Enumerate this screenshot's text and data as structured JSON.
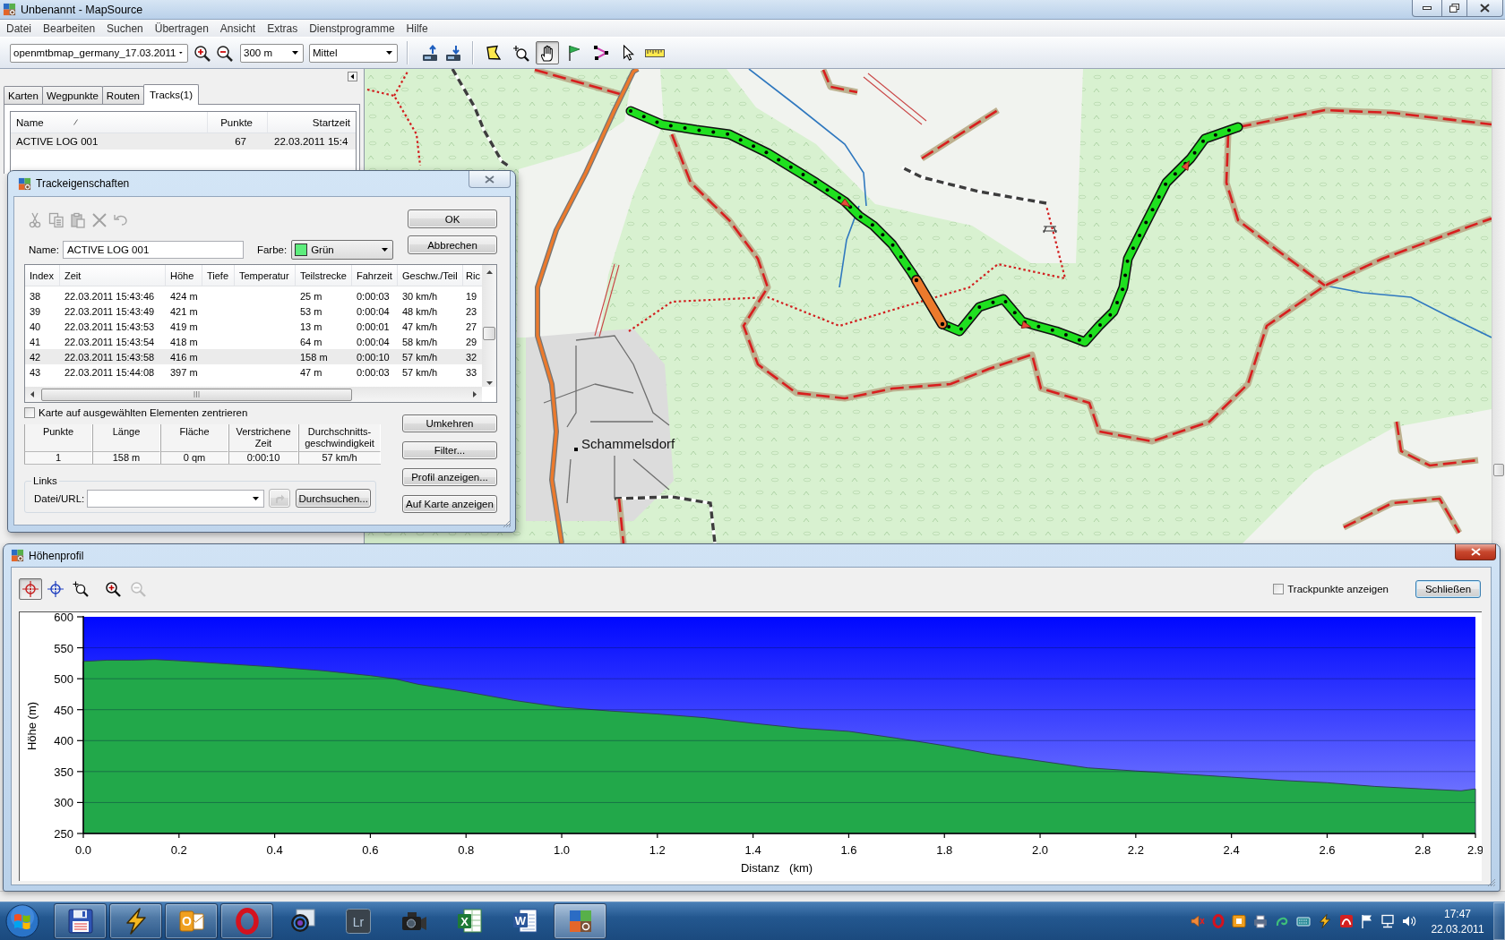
{
  "window": {
    "title": "Unbenannt - MapSource"
  },
  "menu": [
    "Datei",
    "Bearbeiten",
    "Suchen",
    "Übertragen",
    "Ansicht",
    "Extras",
    "Dienstprogramme",
    "Hilfe"
  ],
  "toolbar": {
    "map_product": "openmtbmap_germany_17.03.2011",
    "scale": "300 m",
    "detail": "Mittel",
    "tools": [
      {
        "kind": "area-select",
        "selected": false
      },
      {
        "kind": "zoom",
        "selected": false
      },
      {
        "kind": "hand",
        "selected": true
      },
      {
        "kind": "waypoint",
        "selected": false
      },
      {
        "kind": "route",
        "selected": false
      },
      {
        "kind": "pointer",
        "selected": false
      },
      {
        "kind": "measure",
        "selected": false
      }
    ]
  },
  "sidebar": {
    "tabs": [
      {
        "label": "Karten",
        "selected": false
      },
      {
        "label": "Wegpunkte",
        "selected": false
      },
      {
        "label": "Routen",
        "selected": false
      },
      {
        "label": "Tracks(1)",
        "selected": true
      }
    ],
    "columns": [
      "Name",
      "Punkte",
      "Startzeit"
    ],
    "tracks": [
      {
        "name": "ACTIVE LOG 001",
        "points": "67",
        "start_time": "22.03.2011 15:4",
        "selected": true
      }
    ]
  },
  "map": {
    "place_label": "Schammelsdorf"
  },
  "track_dialog": {
    "title": "Trackeigenschaften",
    "edit_tools": [
      {
        "kind": "cut",
        "disabled": true
      },
      {
        "kind": "copy",
        "disabled": true
      },
      {
        "kind": "paste",
        "disabled": true
      },
      {
        "kind": "delete",
        "disabled": true
      },
      {
        "kind": "undo",
        "disabled": true
      }
    ],
    "name_label": "Name:",
    "name": "ACTIVE LOG 001",
    "color_label": "Farbe:",
    "color": {
      "label": "Grün",
      "color": "#5ded7c"
    },
    "buttons": [
      "OK",
      "Abbrechen"
    ],
    "table": {
      "columns": [
        "Index",
        "Zeit",
        "Höhe",
        "Tiefe",
        "Temperatur",
        "Teilstrecke",
        "Fahrzeit",
        "Geschw./Teil",
        "Ric"
      ],
      "rows": [
        {
          "index": "38",
          "time": "22.03.2011 15:43:46",
          "elevation": "424 m",
          "leg_distance": "25 m",
          "leg_time": "0:00:03",
          "leg_speed": "30 km/h",
          "column_9": "19",
          "selected": false
        },
        {
          "index": "39",
          "time": "22.03.2011 15:43:49",
          "elevation": "421 m",
          "leg_distance": "53 m",
          "leg_time": "0:00:04",
          "leg_speed": "48 km/h",
          "column_9": "23",
          "selected": false
        },
        {
          "index": "40",
          "time": "22.03.2011 15:43:53",
          "elevation": "419 m",
          "leg_distance": "13 m",
          "leg_time": "0:00:01",
          "leg_speed": "47 km/h",
          "column_9": "27",
          "selected": false
        },
        {
          "index": "41",
          "time": "22.03.2011 15:43:54",
          "elevation": "418 m",
          "leg_distance": "64 m",
          "leg_time": "0:00:04",
          "leg_speed": "58 km/h",
          "column_9": "29",
          "selected": false
        },
        {
          "index": "42",
          "time": "22.03.2011 15:43:58",
          "elevation": "416 m",
          "leg_distance": "158 m",
          "leg_time": "0:00:10",
          "leg_speed": "57 km/h",
          "column_9": "32",
          "selected": true
        },
        {
          "index": "43",
          "time": "22.03.2011 15:44:08",
          "elevation": "397 m",
          "leg_distance": "47 m",
          "leg_time": "0:00:03",
          "leg_speed": "57 km/h",
          "column_9": "33",
          "selected": false
        }
      ]
    },
    "center_map": {
      "label": "Karte auf ausgewählten Elementen zentrieren",
      "checked": false
    },
    "summary": {
      "columns": [
        "Punkte",
        "Länge",
        "Fläche",
        "Verstrichene Zeit",
        "Durchschnitts-geschwindigkeit"
      ],
      "values": [
        "1",
        "158 m",
        "0 qm",
        "0:00:10",
        "57 km/h"
      ]
    },
    "links": {
      "legend": "Links",
      "label": "Datei/URL:",
      "go_disabled": true,
      "browse": "Durchsuchen..."
    },
    "actions": [
      "Umkehren",
      "Filter...",
      "Profil anzeigen...",
      "Auf Karte anzeigen"
    ]
  },
  "profile_window": {
    "title": "Höhenprofil",
    "tools": [
      {
        "kind": "cursor-cross",
        "selected": true,
        "disabled": false
      },
      {
        "kind": "point-cross",
        "selected": false,
        "disabled": false
      },
      {
        "kind": "zoom-area",
        "selected": false,
        "disabled": false
      },
      {
        "kind": "zoom-in",
        "selected": false,
        "disabled": false
      },
      {
        "kind": "zoom-out",
        "selected": false,
        "disabled": true
      }
    ],
    "show_points": {
      "label": "Trackpunkte anzeigen",
      "checked": false
    },
    "close_button": "Schließen",
    "chart_data": {
      "type": "area",
      "grid": true,
      "xlabel": "Distanz   (km)",
      "ylabel": "Höhe (m)",
      "x": [
        0,
        0.05,
        0.1,
        0.15,
        0.2,
        0.3,
        0.4,
        0.5,
        0.6,
        0.65,
        0.7,
        0.8,
        0.9,
        1.0,
        1.1,
        1.2,
        1.3,
        1.4,
        1.5,
        1.6,
        1.7,
        1.8,
        1.9,
        2.0,
        2.1,
        2.2,
        2.3,
        2.4,
        2.5,
        2.6,
        2.7,
        2.8,
        2.88,
        2.91
      ],
      "series": [
        {
          "color": "#22a84a",
          "values": [
            528,
            530,
            530,
            531,
            529,
            524,
            519,
            513,
            505,
            500,
            491,
            479,
            465,
            454,
            448,
            443,
            437,
            428,
            420,
            415,
            404,
            392,
            378,
            367,
            356,
            351,
            346,
            341,
            336,
            332,
            326,
            322,
            319,
            322
          ]
        }
      ],
      "xlim": [
        0,
        2.91
      ],
      "ylim": [
        250,
        600
      ],
      "xticks": [
        {
          "value": 0,
          "label": "0.0"
        },
        0.2,
        0.4,
        0.6,
        0.8,
        {
          "value": 1,
          "label": "1.0"
        },
        1.2,
        1.4,
        1.6,
        1.8,
        {
          "value": 2,
          "label": "2.0"
        },
        2.2,
        2.4,
        2.6,
        2.8,
        {
          "value": 2.91,
          "label": "2.9"
        }
      ],
      "yticks": [
        250,
        300,
        350,
        400,
        450,
        500,
        550,
        600
      ]
    }
  },
  "taskbar": {
    "apps": [
      {
        "kind": "floppy",
        "running": true,
        "selected": false
      },
      {
        "kind": "lightning",
        "running": true,
        "selected": false
      },
      {
        "kind": "mail",
        "label": "O",
        "running": true,
        "selected": false
      },
      {
        "kind": "ring",
        "running": true,
        "selected": false
      },
      {
        "kind": "lens",
        "running": false,
        "selected": false
      },
      {
        "kind": "tile",
        "label": "Lr",
        "running": false,
        "selected": false
      },
      {
        "kind": "camera",
        "running": false,
        "selected": false
      },
      {
        "kind": "sheet",
        "label": "X",
        "running": false,
        "selected": false
      },
      {
        "kind": "doc",
        "label": "W",
        "running": false,
        "selected": false
      },
      {
        "kind": "map-app",
        "running": true,
        "selected": true
      }
    ],
    "tray": [
      {
        "kind": "speaker"
      },
      {
        "kind": "ring"
      },
      {
        "kind": "mail"
      },
      {
        "kind": "printer"
      },
      {
        "kind": "swirl"
      },
      {
        "kind": "keyboard"
      },
      {
        "kind": "lightning"
      },
      {
        "kind": "arc"
      },
      {
        "kind": "flag"
      },
      {
        "kind": "network"
      },
      {
        "kind": "volume"
      }
    ],
    "clock": {
      "time": "17:47",
      "date": "22.03.2011"
    }
  }
}
